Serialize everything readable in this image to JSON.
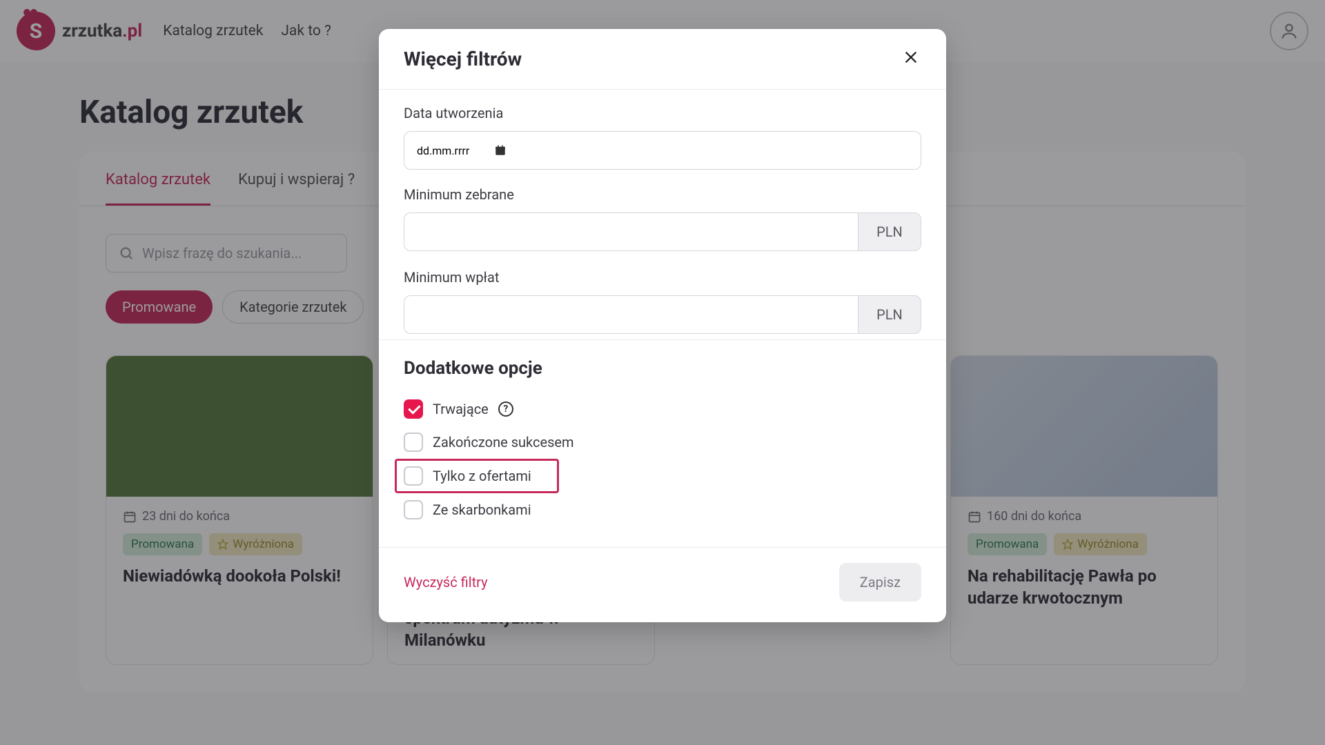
{
  "brand": {
    "name": "zrzutka",
    "tld": ".pl",
    "mark": "S"
  },
  "nav": {
    "catalog": "Katalog zrzutek",
    "how": "Jak to ?"
  },
  "page": {
    "title": "Katalog zrzutek"
  },
  "tabs": {
    "catalog": "Katalog zrzutek",
    "shop": "Kupuj i wspieraj ?"
  },
  "search": {
    "placeholder": "Wpisz frazę do szukania..."
  },
  "pills": {
    "promoted": "Promowane",
    "categories": "Kategorie zrzutek"
  },
  "cards": [
    {
      "days": "23 dni do końca",
      "badge_promo": "Promowana",
      "badge_feat": "Wyróżniona",
      "title": "Niewiadówką dookoła Polski!"
    },
    {
      "days": "",
      "badge_promo": "",
      "badge_feat": "",
      "title": "spektrum autyzmu w Milanówku"
    },
    {
      "days": "160 dni do końca",
      "badge_promo": "Promowana",
      "badge_feat": "Wyróżniona",
      "title": "Na rehabilitację Pawła po udarze krwotocznym"
    }
  ],
  "modal": {
    "title": "Więcej filtrów",
    "date_label": "Data utworzenia",
    "date_placeholder": "dd.mm.rrrr",
    "min_collected_label": "Minimum zebrane",
    "min_payments_label": "Minimum wpłat",
    "currency": "PLN",
    "options_title": "Dodatkowe opcje",
    "opt_ongoing": "Trwające",
    "opt_success": "Zakończone sukcesem",
    "opt_offers": "Tylko z ofertami",
    "opt_piggy": "Ze skarbonkami",
    "clear": "Wyczyść filtry",
    "save": "Zapisz"
  }
}
